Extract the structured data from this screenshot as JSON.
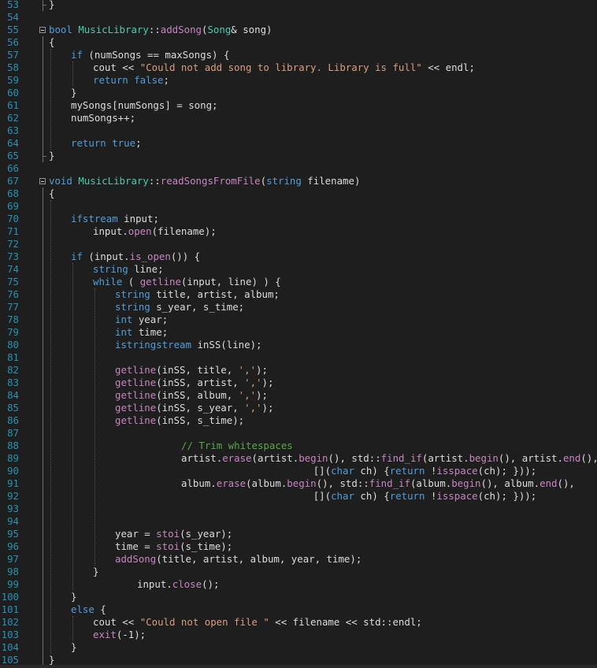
{
  "editor": {
    "lines": [
      {
        "num": "53",
        "indent": 0,
        "tokens": [
          {
            "t": "}",
            "c": ""
          }
        ]
      },
      {
        "num": "54",
        "indent": 0,
        "tokens": []
      },
      {
        "num": "55",
        "indent": 0,
        "tokens": [
          {
            "t": "bool ",
            "c": "kw"
          },
          {
            "t": "MusicLibrary",
            "c": "ty"
          },
          {
            "t": "::",
            "c": ""
          },
          {
            "t": "addSong",
            "c": "fn"
          },
          {
            "t": "(",
            "c": ""
          },
          {
            "t": "Song",
            "c": "ty"
          },
          {
            "t": "& song)",
            "c": ""
          }
        ]
      },
      {
        "num": "56",
        "indent": 0,
        "tokens": [
          {
            "t": "{",
            "c": ""
          }
        ]
      },
      {
        "num": "57",
        "indent": 1,
        "tokens": [
          {
            "t": "if",
            "c": "kw"
          },
          {
            "t": " (numSongs == maxSongs) {",
            "c": ""
          }
        ]
      },
      {
        "num": "58",
        "indent": 2,
        "tokens": [
          {
            "t": "cout << ",
            "c": ""
          },
          {
            "t": "\"Could not add song to library. Library is full\"",
            "c": "st"
          },
          {
            "t": " << endl;",
            "c": ""
          }
        ]
      },
      {
        "num": "59",
        "indent": 2,
        "tokens": [
          {
            "t": "return ",
            "c": "kw"
          },
          {
            "t": "false",
            "c": "kw"
          },
          {
            "t": ";",
            "c": ""
          }
        ]
      },
      {
        "num": "60",
        "indent": 1,
        "tokens": [
          {
            "t": "}",
            "c": ""
          }
        ]
      },
      {
        "num": "61",
        "indent": 1,
        "tokens": [
          {
            "t": "mySongs[numSongs] = song;",
            "c": ""
          }
        ]
      },
      {
        "num": "62",
        "indent": 1,
        "tokens": [
          {
            "t": "numSongs++;",
            "c": ""
          }
        ]
      },
      {
        "num": "63",
        "indent": 0,
        "tokens": []
      },
      {
        "num": "64",
        "indent": 1,
        "tokens": [
          {
            "t": "return ",
            "c": "kw"
          },
          {
            "t": "true",
            "c": "kw"
          },
          {
            "t": ";",
            "c": ""
          }
        ]
      },
      {
        "num": "65",
        "indent": 0,
        "tokens": [
          {
            "t": "}",
            "c": ""
          }
        ]
      },
      {
        "num": "66",
        "indent": 0,
        "tokens": []
      },
      {
        "num": "67",
        "indent": 0,
        "tokens": [
          {
            "t": "void ",
            "c": "kw"
          },
          {
            "t": "MusicLibrary",
            "c": "ty"
          },
          {
            "t": "::",
            "c": ""
          },
          {
            "t": "readSongsFromFile",
            "c": "fn"
          },
          {
            "t": "(",
            "c": ""
          },
          {
            "t": "string",
            "c": "kw"
          },
          {
            "t": " filename)",
            "c": ""
          }
        ]
      },
      {
        "num": "68",
        "indent": 0,
        "tokens": [
          {
            "t": "{",
            "c": ""
          }
        ]
      },
      {
        "num": "69",
        "indent": 0,
        "tokens": []
      },
      {
        "num": "70",
        "indent": 1,
        "tokens": [
          {
            "t": "ifstream",
            "c": "kw"
          },
          {
            "t": " input;",
            "c": ""
          }
        ]
      },
      {
        "num": "71",
        "indent": 2,
        "tokens": [
          {
            "t": "input.",
            "c": ""
          },
          {
            "t": "open",
            "c": "fn"
          },
          {
            "t": "(filename);",
            "c": ""
          }
        ]
      },
      {
        "num": "72",
        "indent": 0,
        "tokens": []
      },
      {
        "num": "73",
        "indent": 1,
        "tokens": [
          {
            "t": "if",
            "c": "kw"
          },
          {
            "t": " (input.",
            "c": ""
          },
          {
            "t": "is_open",
            "c": "fn"
          },
          {
            "t": "()) {",
            "c": ""
          }
        ]
      },
      {
        "num": "74",
        "indent": 2,
        "tokens": [
          {
            "t": "string",
            "c": "kw"
          },
          {
            "t": " line;",
            "c": ""
          }
        ]
      },
      {
        "num": "75",
        "indent": 2,
        "tokens": [
          {
            "t": "while",
            "c": "kw"
          },
          {
            "t": " ( ",
            "c": ""
          },
          {
            "t": "getline",
            "c": "fn"
          },
          {
            "t": "(input, line) ) {",
            "c": ""
          }
        ]
      },
      {
        "num": "76",
        "indent": 3,
        "tokens": [
          {
            "t": "string",
            "c": "kw"
          },
          {
            "t": " title, artist, album;",
            "c": ""
          }
        ]
      },
      {
        "num": "77",
        "indent": 3,
        "tokens": [
          {
            "t": "string",
            "c": "kw"
          },
          {
            "t": " s_year, s_time;",
            "c": ""
          }
        ]
      },
      {
        "num": "78",
        "indent": 3,
        "tokens": [
          {
            "t": "int",
            "c": "kw"
          },
          {
            "t": " year;",
            "c": ""
          }
        ]
      },
      {
        "num": "79",
        "indent": 3,
        "tokens": [
          {
            "t": "int",
            "c": "kw"
          },
          {
            "t": " time;",
            "c": ""
          }
        ]
      },
      {
        "num": "80",
        "indent": 3,
        "tokens": [
          {
            "t": "istringstream",
            "c": "kw"
          },
          {
            "t": " inSS(line);",
            "c": ""
          }
        ]
      },
      {
        "num": "81",
        "indent": 0,
        "tokens": []
      },
      {
        "num": "82",
        "indent": 3,
        "tokens": [
          {
            "t": "getline",
            "c": "fn"
          },
          {
            "t": "(inSS, title, ",
            "c": ""
          },
          {
            "t": "','",
            "c": "st"
          },
          {
            "t": ");",
            "c": ""
          }
        ]
      },
      {
        "num": "83",
        "indent": 3,
        "tokens": [
          {
            "t": "getline",
            "c": "fn"
          },
          {
            "t": "(inSS, artist, ",
            "c": ""
          },
          {
            "t": "','",
            "c": "st"
          },
          {
            "t": ");",
            "c": ""
          }
        ]
      },
      {
        "num": "84",
        "indent": 3,
        "tokens": [
          {
            "t": "getline",
            "c": "fn"
          },
          {
            "t": "(inSS, album, ",
            "c": ""
          },
          {
            "t": "','",
            "c": "st"
          },
          {
            "t": ");",
            "c": ""
          }
        ]
      },
      {
        "num": "85",
        "indent": 3,
        "tokens": [
          {
            "t": "getline",
            "c": "fn"
          },
          {
            "t": "(inSS, s_year, ",
            "c": ""
          },
          {
            "t": "','",
            "c": "st"
          },
          {
            "t": ");",
            "c": ""
          }
        ]
      },
      {
        "num": "86",
        "indent": 3,
        "tokens": [
          {
            "t": "getline",
            "c": "fn"
          },
          {
            "t": "(inSS, s_time);",
            "c": ""
          }
        ]
      },
      {
        "num": "87",
        "indent": 0,
        "tokens": []
      },
      {
        "num": "88",
        "indent": 6,
        "tokens": [
          {
            "t": "// Trim whitespaces",
            "c": "cm"
          }
        ]
      },
      {
        "num": "89",
        "indent": 6,
        "tokens": [
          {
            "t": "artist.",
            "c": ""
          },
          {
            "t": "erase",
            "c": "fn"
          },
          {
            "t": "(artist.",
            "c": ""
          },
          {
            "t": "begin",
            "c": "fn"
          },
          {
            "t": "(), std::",
            "c": ""
          },
          {
            "t": "find_if",
            "c": "fn"
          },
          {
            "t": "(artist.",
            "c": ""
          },
          {
            "t": "begin",
            "c": "fn"
          },
          {
            "t": "(), artist.",
            "c": ""
          },
          {
            "t": "end",
            "c": "fn"
          },
          {
            "t": "(),",
            "c": ""
          }
        ]
      },
      {
        "num": "90",
        "indent": 0,
        "pad": "                                             ",
        "tokens": [
          {
            "t": "[](",
            "c": ""
          },
          {
            "t": "char",
            "c": "kw"
          },
          {
            "t": " ch) {",
            "c": ""
          },
          {
            "t": "return",
            "c": "kw"
          },
          {
            "t": " !",
            "c": ""
          },
          {
            "t": "isspace",
            "c": "fn"
          },
          {
            "t": "(ch); }));",
            "c": ""
          }
        ]
      },
      {
        "num": "91",
        "indent": 6,
        "tokens": [
          {
            "t": "album.",
            "c": ""
          },
          {
            "t": "erase",
            "c": "fn"
          },
          {
            "t": "(album.",
            "c": ""
          },
          {
            "t": "begin",
            "c": "fn"
          },
          {
            "t": "(), std::",
            "c": ""
          },
          {
            "t": "find_if",
            "c": "fn"
          },
          {
            "t": "(album.",
            "c": ""
          },
          {
            "t": "begin",
            "c": "fn"
          },
          {
            "t": "(), album.",
            "c": ""
          },
          {
            "t": "end",
            "c": "fn"
          },
          {
            "t": "(),",
            "c": ""
          }
        ]
      },
      {
        "num": "92",
        "indent": 0,
        "pad": "                                             ",
        "tokens": [
          {
            "t": "[](",
            "c": ""
          },
          {
            "t": "char",
            "c": "kw"
          },
          {
            "t": " ch) {",
            "c": ""
          },
          {
            "t": "return",
            "c": "kw"
          },
          {
            "t": " !",
            "c": ""
          },
          {
            "t": "isspace",
            "c": "fn"
          },
          {
            "t": "(ch); }));",
            "c": ""
          }
        ]
      },
      {
        "num": "93",
        "indent": 0,
        "tokens": []
      },
      {
        "num": "94",
        "indent": 0,
        "tokens": []
      },
      {
        "num": "95",
        "indent": 3,
        "tokens": [
          {
            "t": "year = ",
            "c": ""
          },
          {
            "t": "stoi",
            "c": "fn"
          },
          {
            "t": "(s_year);",
            "c": ""
          }
        ]
      },
      {
        "num": "96",
        "indent": 3,
        "tokens": [
          {
            "t": "time = ",
            "c": ""
          },
          {
            "t": "stoi",
            "c": "fn"
          },
          {
            "t": "(s_time);",
            "c": ""
          }
        ]
      },
      {
        "num": "97",
        "indent": 3,
        "tokens": [
          {
            "t": "addSong",
            "c": "fn"
          },
          {
            "t": "(title, artist, album, year, time);",
            "c": ""
          }
        ]
      },
      {
        "num": "98",
        "indent": 2,
        "tokens": [
          {
            "t": "}",
            "c": ""
          }
        ]
      },
      {
        "num": "99",
        "indent": 4,
        "tokens": [
          {
            "t": "input.",
            "c": ""
          },
          {
            "t": "close",
            "c": "fn"
          },
          {
            "t": "();",
            "c": ""
          }
        ]
      },
      {
        "num": "100",
        "indent": 1,
        "tokens": [
          {
            "t": "}",
            "c": ""
          }
        ]
      },
      {
        "num": "101",
        "indent": 1,
        "tokens": [
          {
            "t": "else",
            "c": "kw"
          },
          {
            "t": " {",
            "c": ""
          }
        ]
      },
      {
        "num": "102",
        "indent": 2,
        "tokens": [
          {
            "t": "cout << ",
            "c": ""
          },
          {
            "t": "\"Could not open file \"",
            "c": "st"
          },
          {
            "t": " << filename << std::endl;",
            "c": ""
          }
        ]
      },
      {
        "num": "103",
        "indent": 2,
        "tokens": [
          {
            "t": "exit",
            "c": "fn"
          },
          {
            "t": "(-1);",
            "c": ""
          }
        ]
      },
      {
        "num": "104",
        "indent": 1,
        "tokens": [
          {
            "t": "}",
            "c": ""
          }
        ]
      },
      {
        "num": "105",
        "indent": 0,
        "tokens": [
          {
            "t": "}",
            "c": ""
          }
        ]
      }
    ]
  },
  "colors": {
    "background": "#1e1e1e",
    "line_number": "#2b91af",
    "keyword": "#569cd6",
    "type": "#4ec9b0",
    "function": "#c586c0",
    "string": "#d69d85",
    "comment": "#57a64a",
    "text": "#dcdcdc"
  }
}
